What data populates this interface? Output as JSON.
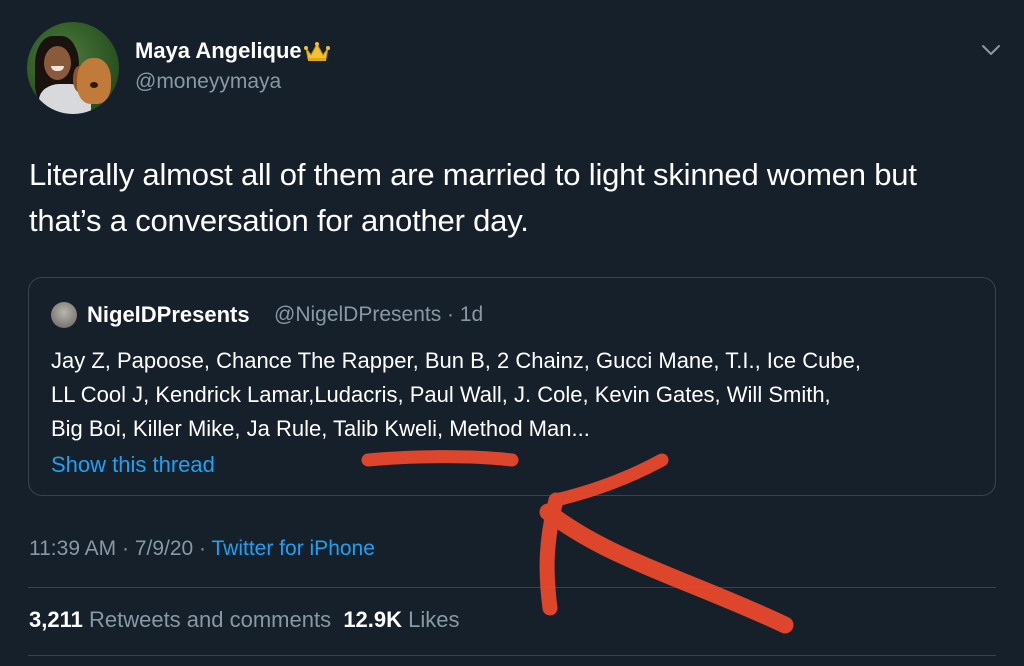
{
  "tweet": {
    "display_name": "Maya Angelique",
    "handle": "@moneyymaya",
    "text_line1": "Literally almost all of them are married to light skinned women but",
    "text_line2": "that’s a conversation for another day.",
    "timestamp": "11:39 AM · 7/9/20 · ",
    "source": "Twitter for iPhone",
    "retweets_count": "3,211",
    "retweets_label": "Retweets and comments",
    "likes_count": "12.9K",
    "likes_label": "Likes"
  },
  "quoted_tweet": {
    "display_name": "NigelDPresents",
    "handle_time": "@NigelDPresents · 1d",
    "line1": "Jay Z, Papoose, Chance The Rapper, Bun B, 2 Chainz, Gucci Mane, T.I., Ice Cube,",
    "line2": "LL Cool J, Kendrick Lamar,Ludacris, Paul Wall,  J. Cole, Kevin Gates, Will Smith,",
    "line3": "Big Boi, Killer Mike, Ja Rule, Talib Kweli, Method Man...",
    "show_thread": "Show this thread"
  },
  "icons": {
    "crown": "crown-icon",
    "menu": "chevron-down-icon"
  },
  "colors": {
    "background": "#15202b",
    "link": "#1da1f2",
    "secondary_text": "#8899a6",
    "annotation": "#e8492c"
  }
}
